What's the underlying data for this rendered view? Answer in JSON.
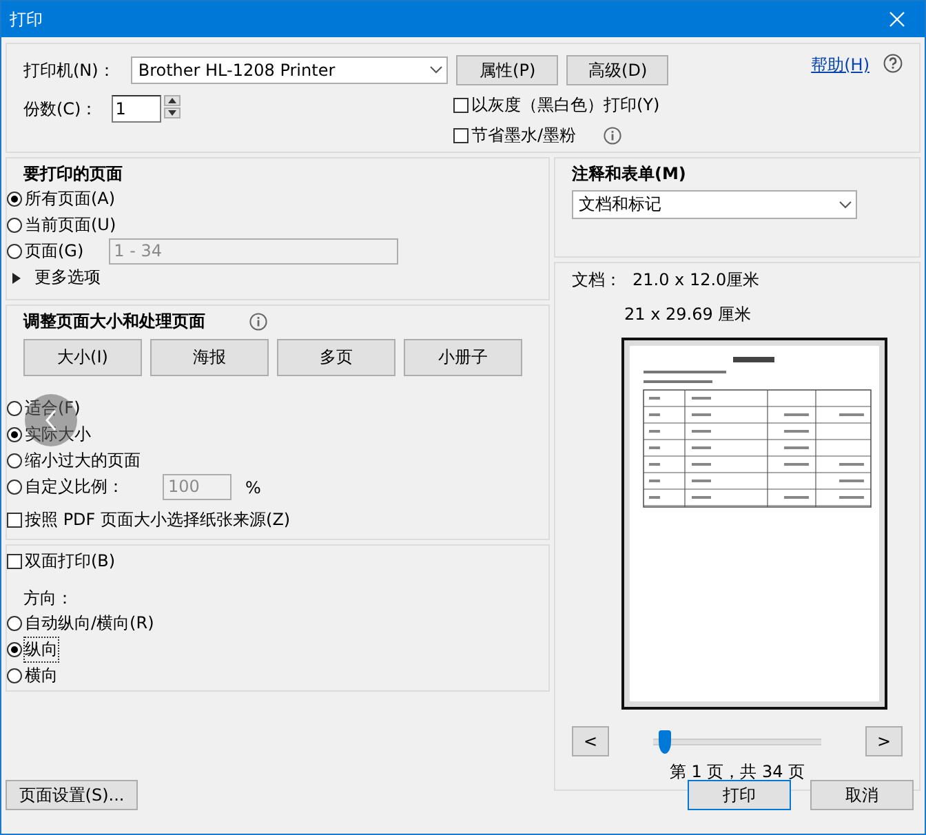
{
  "window": {
    "title": "打印"
  },
  "printer": {
    "label": "打印机(N)：",
    "value": "Brother HL-1208 Printer"
  },
  "top_buttons": [
    "属性(P)",
    "高级(D)"
  ],
  "help": {
    "label": "帮助(H)"
  },
  "copies": {
    "label": "份数(C)：",
    "value": "1"
  },
  "print_options": [
    {
      "label": "以灰度（黑白色）打印(Y)",
      "checked": false,
      "info": false
    },
    {
      "label": "节省墨水/墨粉",
      "checked": false,
      "info": true
    }
  ],
  "pages": {
    "title": "要打印的页面",
    "options": [
      {
        "label": "所有页面(A)",
        "selected": true,
        "kind": "plain"
      },
      {
        "label": "当前页面(U)",
        "selected": false,
        "kind": "plain"
      },
      {
        "label": "页面(G)",
        "selected": false,
        "kind": "range"
      }
    ],
    "range": {
      "value": "1 - 34",
      "disabled": true
    },
    "more": {
      "label": "更多选项",
      "expanded": false
    }
  },
  "sizing": {
    "title": "调整页面大小和处理页面",
    "tabs": [
      "大小(I)",
      "海报",
      "多页",
      "小册子"
    ],
    "options": [
      {
        "label": "适合(F)",
        "selected": false,
        "kind": "plain"
      },
      {
        "label": "实际大小",
        "selected": true,
        "kind": "plain"
      },
      {
        "label": "缩小过大的页面",
        "selected": false,
        "kind": "plain"
      },
      {
        "label": "自定义比例：",
        "selected": false,
        "kind": "scale"
      }
    ],
    "scale": {
      "value": "100",
      "unit": "%",
      "disabled": true
    },
    "pdf_source": {
      "label": "按照 PDF 页面大小选择纸张来源(Z)",
      "checked": false
    }
  },
  "duplex": {
    "label": "双面打印(B)",
    "checked": false
  },
  "orientation": {
    "title": "方向：",
    "options": [
      {
        "label": "自动纵向/横向(R)",
        "selected": false
      },
      {
        "label": "纵向",
        "selected": true
      },
      {
        "label": "横向",
        "selected": false
      }
    ]
  },
  "annotations": {
    "title": "注释和表单(M)",
    "value": "文档和标记"
  },
  "preview": {
    "doc_label": "文档：",
    "doc_size": "21.0 x 12.0厘米",
    "paper_size": "21 x 29.69 厘米",
    "prev": "<",
    "next": ">",
    "slider": {
      "level": 0.03
    },
    "page_info": "第 1 页，共 34 页"
  },
  "footer": {
    "page_setup": "页面设置(S)...",
    "print": "打印",
    "cancel": "取消"
  }
}
